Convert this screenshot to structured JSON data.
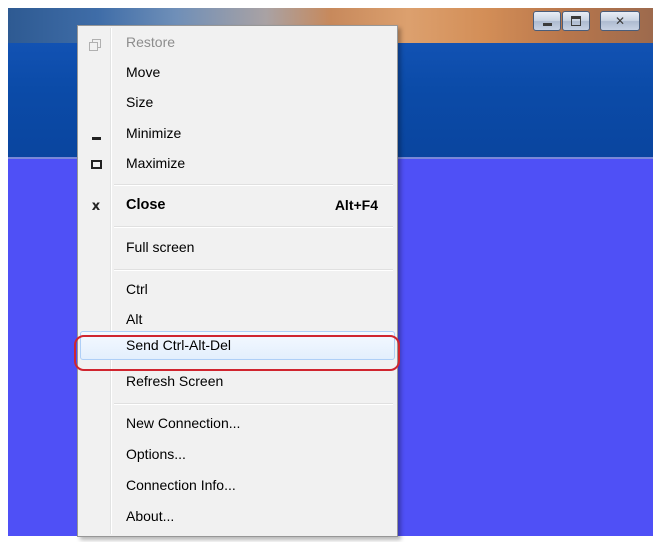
{
  "menu": {
    "items": [
      {
        "label": "Restore",
        "accel": "",
        "icon": "restore-icon",
        "disabled": true
      },
      {
        "label": "Move",
        "accel": "",
        "icon": ""
      },
      {
        "label": "Size",
        "accel": "",
        "icon": ""
      },
      {
        "label": "Minimize",
        "accel": "",
        "icon": "minimize-icon"
      },
      {
        "label": "Maximize",
        "accel": "",
        "icon": "maximize-icon"
      },
      {
        "label": "Close",
        "accel": "Alt+F4",
        "icon": "close-icon",
        "bold": true
      },
      {
        "label": "Full screen",
        "accel": "",
        "icon": ""
      },
      {
        "label": "Ctrl",
        "accel": "",
        "icon": ""
      },
      {
        "label": "Alt",
        "accel": "",
        "icon": ""
      },
      {
        "label": "Send Ctrl-Alt-Del",
        "accel": "",
        "icon": "",
        "highlighted": true,
        "annotated": true
      },
      {
        "label": "Refresh Screen",
        "accel": "",
        "icon": ""
      },
      {
        "label": "New Connection...",
        "accel": "",
        "icon": ""
      },
      {
        "label": "Options...",
        "accel": "",
        "icon": ""
      },
      {
        "label": "Connection Info...",
        "accel": "",
        "icon": ""
      },
      {
        "label": "About...",
        "accel": "",
        "icon": ""
      }
    ]
  },
  "window_controls": [
    "minimize-icon",
    "maximize-icon",
    "close-icon"
  ],
  "colors": {
    "desktop_blue": "#4f50f6",
    "app_band": "#0b4ba8",
    "menu_bg": "#f1f1f1",
    "highlight": "#e3effd",
    "annotation_ring": "#d0252f"
  }
}
